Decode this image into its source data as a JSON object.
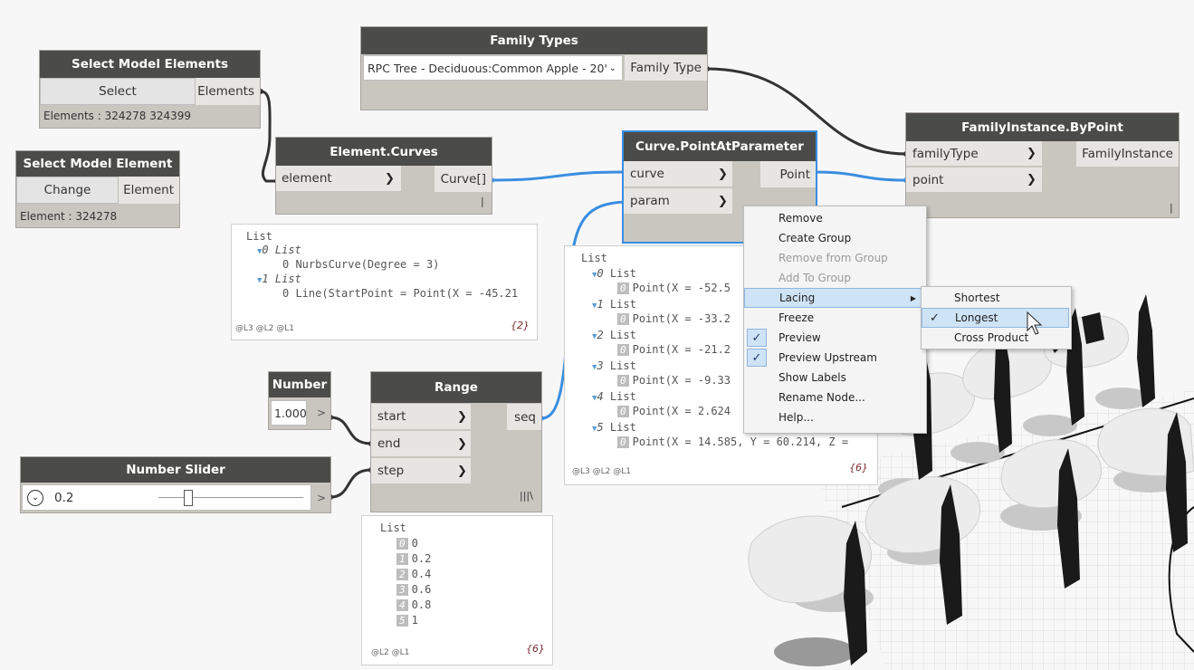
{
  "nodes": {
    "select_model_elements": {
      "title": "Select Model Elements",
      "button": "Select",
      "output": "Elements",
      "info": "Elements : 324278 324399"
    },
    "select_model_element": {
      "title": "Select Model Element",
      "button": "Change",
      "output": "Element",
      "info": "Element : 324278"
    },
    "family_types": {
      "title": "Family Types",
      "dropdown_value": "RPC Tree - Deciduous:Common Apple - 20'",
      "output": "Family Type"
    },
    "element_curves": {
      "title": "Element.Curves",
      "input": "element",
      "output": "Curve[]",
      "lacing_glyph": "|"
    },
    "curve_point_at_parameter": {
      "title": "Curve.PointAtParameter",
      "inputs": [
        "curve",
        "param"
      ],
      "output": "Point"
    },
    "family_instance_by_point": {
      "title": "FamilyInstance.ByPoint",
      "inputs": [
        "familyType",
        "point"
      ],
      "output": "FamilyInstance",
      "lacing_glyph": "|"
    },
    "number": {
      "title": "Number",
      "value": "1.000",
      "output_glyph": ">"
    },
    "range": {
      "title": "Range",
      "inputs": [
        "start",
        "end",
        "step"
      ],
      "output": "seq",
      "lacing_glyph": "|||\\"
    },
    "number_slider": {
      "title": "Number Slider",
      "value": "0.2",
      "output_glyph": ">",
      "slider_fraction": 0.2
    }
  },
  "watches": {
    "curves": {
      "lines": [
        "List",
        "0 List",
        "0 NurbsCurve(Degree = 3)",
        "1 List",
        "0 Line(StartPoint = Point(X = -45.21"
      ],
      "footer": "@L3 @L2 @L1",
      "count": "{2}"
    },
    "points": {
      "header": "List",
      "items": [
        {
          "idx": "0",
          "label": "List",
          "value": "Point(X = -52.5"
        },
        {
          "idx": "1",
          "label": "List",
          "value": "Point(X = -33.2"
        },
        {
          "idx": "2",
          "label": "List",
          "value": "Point(X = -21.2"
        },
        {
          "idx": "3",
          "label": "List",
          "value": "Point(X = -9.33"
        },
        {
          "idx": "4",
          "label": "List",
          "value": "Point(X = 2.624"
        },
        {
          "idx": "5",
          "label": "List",
          "value": "Point(X = 14.585, Y = 60.214, Z ="
        }
      ],
      "footer": "@L3 @L2 @L1",
      "count": "{6}"
    },
    "range": {
      "header": "List",
      "items": [
        {
          "idx": "0",
          "value": "0"
        },
        {
          "idx": "1",
          "value": "0.2"
        },
        {
          "idx": "2",
          "value": "0.4"
        },
        {
          "idx": "3",
          "value": "0.6"
        },
        {
          "idx": "4",
          "value": "0.8"
        },
        {
          "idx": "5",
          "value": "1"
        }
      ],
      "footer": "@L2 @L1",
      "count": "{6}"
    }
  },
  "context_menu": {
    "items": [
      {
        "label": "Remove",
        "enabled": true,
        "checked": false
      },
      {
        "label": "Create Group",
        "enabled": true,
        "checked": false
      },
      {
        "label": "Remove from Group",
        "enabled": false,
        "checked": false
      },
      {
        "label": "Add To Group",
        "enabled": false,
        "checked": false
      },
      {
        "label": "Lacing",
        "enabled": true,
        "checked": false,
        "submenu": true
      },
      {
        "label": "Freeze",
        "enabled": true,
        "checked": false
      },
      {
        "label": "Preview",
        "enabled": true,
        "checked": true
      },
      {
        "label": "Preview Upstream",
        "enabled": true,
        "checked": true
      },
      {
        "label": "Show Labels",
        "enabled": true,
        "checked": false
      },
      {
        "label": "Rename Node...",
        "enabled": true,
        "checked": false
      },
      {
        "label": "Help...",
        "enabled": true,
        "checked": false
      }
    ],
    "lacing_submenu": [
      {
        "label": "Shortest",
        "checked": false
      },
      {
        "label": "Longest",
        "checked": true
      },
      {
        "label": "Cross Product",
        "checked": false
      }
    ]
  },
  "colors": {
    "wire_selected": "#3a8ee0",
    "wire": "#333333",
    "node_header": "#4b4b49",
    "node_body": "#c9c6c0",
    "menu_highlight": "#cfe3f6"
  }
}
